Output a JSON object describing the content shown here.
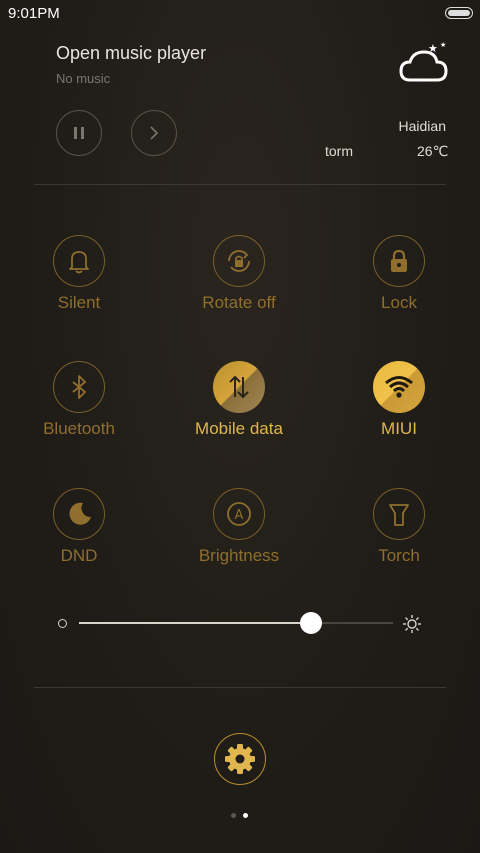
{
  "status_bar": {
    "time": "9:01PM"
  },
  "music": {
    "title": "Open music player",
    "subtitle": "No music"
  },
  "weather": {
    "city": "Haidian",
    "condition": "torm",
    "temperature": "26℃",
    "icon": "cloud-night-icon"
  },
  "toggles": [
    {
      "label": "Silent",
      "icon": "bell-icon",
      "active": false
    },
    {
      "label": "Rotate off",
      "icon": "rotate-lock-icon",
      "active": false
    },
    {
      "label": "Lock",
      "icon": "lock-icon",
      "active": false
    },
    {
      "label": "Bluetooth",
      "icon": "bluetooth-icon",
      "active": false
    },
    {
      "label": "Mobile data",
      "icon": "mobile-data-icon",
      "active": true
    },
    {
      "label": "MIUI",
      "icon": "wifi-icon",
      "active": true
    },
    {
      "label": "DND",
      "icon": "moon-icon",
      "active": false
    },
    {
      "label": "Brightness",
      "icon": "auto-brightness-icon",
      "active": false
    },
    {
      "label": "Torch",
      "icon": "torch-icon",
      "active": false
    }
  ],
  "brightness": {
    "level": 0.74
  },
  "pager": {
    "pages": 2,
    "current": 2
  },
  "colors": {
    "accent": "#e0b64e",
    "inactive": "#8f6e2e",
    "background": "#201d18"
  }
}
